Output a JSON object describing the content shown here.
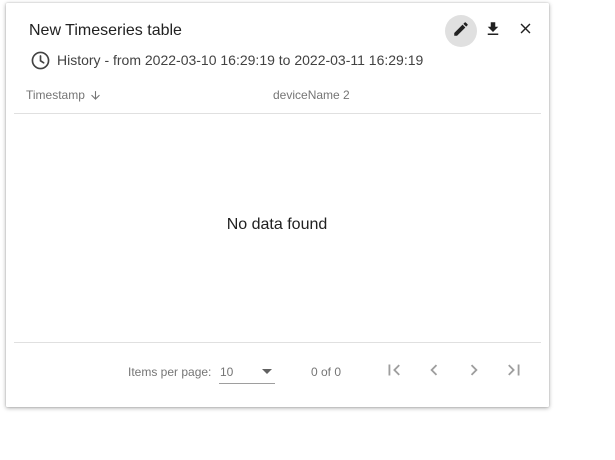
{
  "widget": {
    "title": "New Timeseries table",
    "subtitle": "History - from 2022-03-10 16:29:19 to 2022-03-11 16:29:19",
    "subtitle_icon": "clock-icon",
    "actions": [
      {
        "icon": "pencil-icon",
        "active": true
      },
      {
        "icon": "download-icon",
        "active": false
      },
      {
        "icon": "close-icon",
        "active": false
      }
    ]
  },
  "table": {
    "columns": [
      {
        "label": "Timestamp",
        "sort": "descending"
      },
      {
        "label": "deviceName 2"
      }
    ],
    "rows": [],
    "empty_message": "No data found"
  },
  "paginator": {
    "items_per_page_label": "Items per page:",
    "items_per_page_value": "10",
    "range_label": "0 of 0",
    "buttons": [
      "first-page-icon",
      "previous-page-icon",
      "next-page-icon",
      "last-page-icon"
    ]
  },
  "colors": {
    "text_primary": "#212121",
    "text_secondary": "#757575",
    "icon_active_bg": "#e0e0e0",
    "icon_disabled": "#9e9e9e",
    "divider": "#e0e0e0"
  }
}
